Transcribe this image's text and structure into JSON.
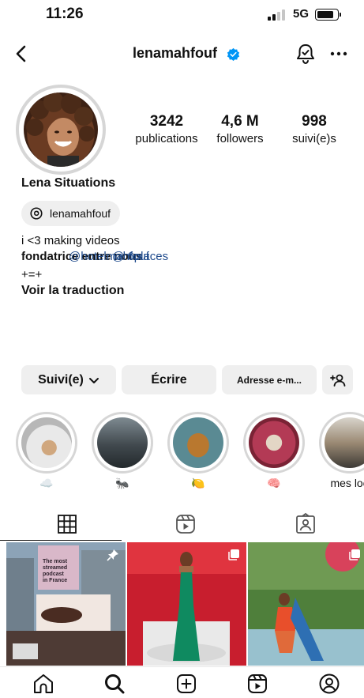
{
  "status_bar": {
    "time": "11:26",
    "network": "5G",
    "battery_level": 0.8,
    "signal_bars": 4,
    "signal_active": 2
  },
  "header": {
    "username": "lenamahfouf",
    "verified": true
  },
  "profile": {
    "stats": [
      {
        "value": "3242",
        "label": "publications"
      },
      {
        "value": "4,6 M",
        "label": "followers"
      },
      {
        "value": "998",
        "label": "suivi(e)s"
      }
    ],
    "display_name": "Lena Situations",
    "threads_handle": "lenamahfouf",
    "bio": {
      "line1": "i <3 making videos",
      "overlap_a": "fondatrice entre nous",
      "overlap_b": "@hotelmahfouf",
      "overlap_c": "@ 6places",
      "line3": "+=+",
      "translate": "Voir la traduction"
    }
  },
  "actions": {
    "follow": "Suivi(e)",
    "message": "Écrire",
    "address": "Adresse e-m..."
  },
  "highlights": [
    {
      "label": "☁️",
      "color": "#cfcfcf",
      "icon": "cloud-emoji"
    },
    {
      "label": "🐜",
      "color": "#3a3d3f",
      "icon": "ant-emoji"
    },
    {
      "label": "🍋",
      "color": "#c8842f",
      "icon": "lemon-emoji"
    },
    {
      "label": "🧠",
      "color": "#b23a57",
      "icon": "brain-emoji"
    },
    {
      "label": "mes loo",
      "color": "#b9a48a",
      "icon": ""
    }
  ],
  "posts": [
    {
      "type": "pinned",
      "caption": "The most streamed podcast in France"
    },
    {
      "type": "multi"
    },
    {
      "type": "multi"
    }
  ],
  "colors": {
    "accent": "#0095f6",
    "mention": "#1e4a8c",
    "button_bg": "#efefef"
  }
}
